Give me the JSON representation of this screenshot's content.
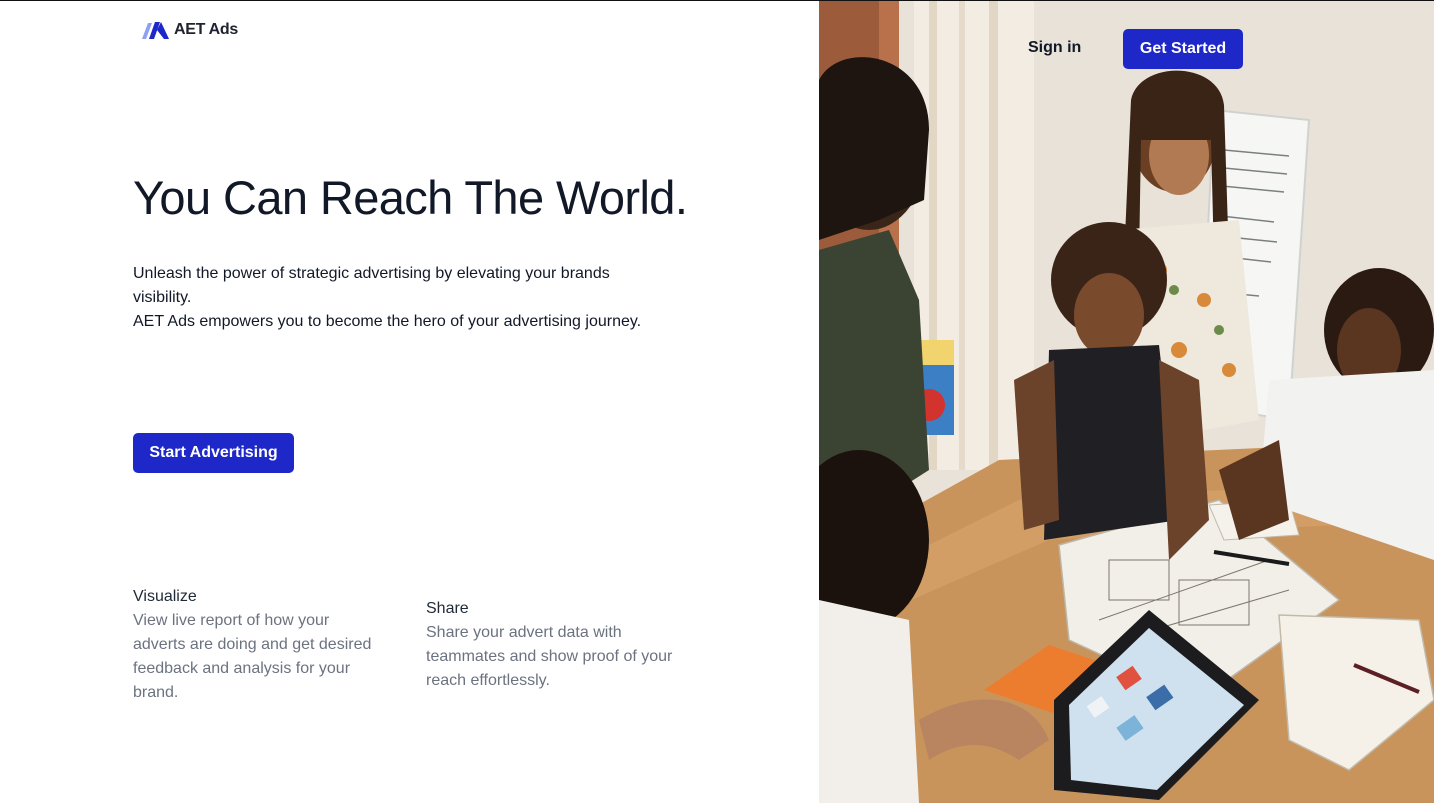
{
  "brand": {
    "name": "AET Ads",
    "accent_color": "#1e27c8"
  },
  "header": {
    "signin_label": "Sign in",
    "get_started_label": "Get Started"
  },
  "hero": {
    "headline": "You Can Reach The World.",
    "subtext_line1": "Unleash the power of strategic advertising by elevating your brands visibility.",
    "subtext_line2": "AET Ads empowers you to become the hero of your advertising journey.",
    "cta_label": "Start Advertising"
  },
  "features": [
    {
      "title": "Visualize",
      "description": "View live report of how your adverts are doing and get desired feedback and analysis for your brand."
    },
    {
      "title": "Share",
      "description": "Share your advert data with teammates and show proof of your reach effortlessly."
    }
  ],
  "photo": {
    "icon": "team-collaboration-photo"
  }
}
